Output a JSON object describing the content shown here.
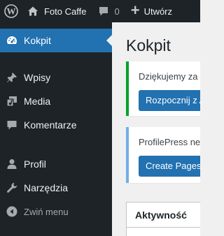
{
  "admin_bar": {
    "site_name": "Foto Caffe",
    "comments_count": "0",
    "new_label": "Utwórz"
  },
  "menu": {
    "items": [
      {
        "label": "Kokpit",
        "icon": "dashboard-icon"
      },
      {
        "label": "Wpisy",
        "icon": "pin-icon"
      },
      {
        "label": "Media",
        "icon": "media-icon"
      },
      {
        "label": "Komentarze",
        "icon": "comment-icon"
      },
      {
        "label": "Profil",
        "icon": "user-icon"
      },
      {
        "label": "Narzędzia",
        "icon": "wrench-icon"
      }
    ],
    "collapse_label": "Zwiń menu"
  },
  "main": {
    "title": "Kokpit",
    "notice_success": {
      "text": "Dziękujemy za w",
      "button": "Rozpocznij z A"
    },
    "notice_info": {
      "text": "ProfilePress nee",
      "button": "Create Pages"
    },
    "activity_title": "Aktywność"
  },
  "colors": {
    "admin_dark": "#1d2327",
    "accent_blue": "#2271b1",
    "success_green": "#00a32a",
    "info_blue": "#72aee6",
    "background": "#f0f0f1"
  }
}
